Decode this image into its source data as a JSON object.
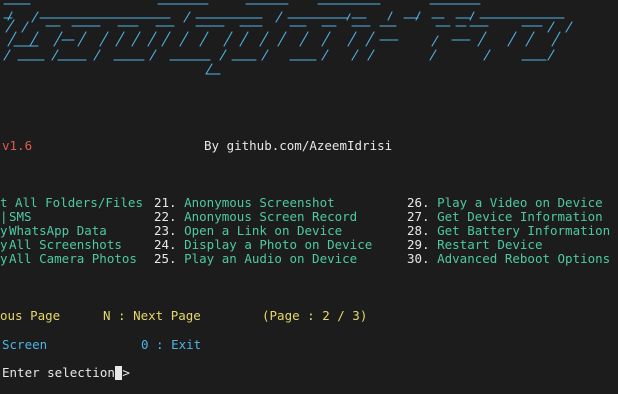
{
  "version": "v1.6",
  "credit": "By github.com/AzeemIdrisi",
  "menu": {
    "col1": [
      {
        "label": "t All Folders/Files"
      },
      {
        "label": "SMS"
      },
      {
        "label": "WhatsApp Data"
      },
      {
        "label": "All Screenshots"
      },
      {
        "label": "All Camera Photos"
      }
    ],
    "col2": [
      {
        "num": "21.",
        "label": "Anonymous Screenshot"
      },
      {
        "num": "22.",
        "label": "Anonymous Screen Record"
      },
      {
        "num": "23.",
        "label": "Open a Link on Device"
      },
      {
        "num": "24.",
        "label": "Display a Photo on Device"
      },
      {
        "num": "25.",
        "label": "Play an Audio on Device"
      }
    ],
    "col3": [
      {
        "num": "26.",
        "label": "Play a Video on Device"
      },
      {
        "num": "27.",
        "label": "Get Device Information"
      },
      {
        "num": "28.",
        "label": "Get Battery Information"
      },
      {
        "num": "29.",
        "label": "Restart Device"
      },
      {
        "num": "30.",
        "label": "Advanced Reboot Options"
      }
    ]
  },
  "nav": {
    "prev": "ous Page",
    "next": "N : Next Page",
    "page": "(Page : 2 / 3)"
  },
  "footer": {
    "screen": "Screen",
    "exit": "0 : Exit"
  },
  "prompt": "Enter selection >",
  "colors": {
    "background": "#1c1c1c",
    "banner": "#4fb3e6",
    "version": "#e05a52",
    "option": "#4ec9a4",
    "navigation": "#e6d86a"
  }
}
